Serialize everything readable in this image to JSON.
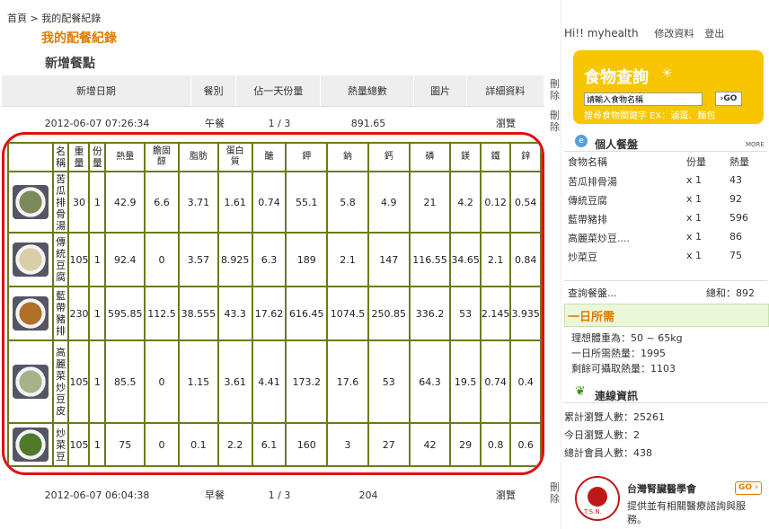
{
  "breadcrumb": {
    "home": "首頁",
    "sep": ">",
    "current": "我的配餐紀錄"
  },
  "page_title": "我的配餐紀錄",
  "section_title": "新增餐點",
  "meal_table": {
    "headers": [
      "新增日期",
      "餐別",
      "佔一天份量",
      "熱量總數",
      "圖片",
      "詳細資料"
    ],
    "delete_label": "刪除",
    "rows": [
      {
        "date": "2012-06-07 07:26:34",
        "meal": "午餐",
        "portion": "1 / 3",
        "calories": "891.65",
        "detail": "瀏覽"
      },
      {
        "date": "2012-06-07 06:04:38",
        "meal": "早餐",
        "portion": "1 / 3",
        "calories": "204",
        "detail": "瀏覽"
      }
    ]
  },
  "nutrition": {
    "headers": [
      "",
      "名稱",
      "重量",
      "份量",
      "熱量",
      "膽固醇",
      "脂肪",
      "蛋白質",
      "醣",
      "鉀",
      "鈉",
      "鈣",
      "磷",
      "鎂",
      "鐵",
      "鋅"
    ],
    "rows": [
      {
        "name": "苦瓜排骨湯",
        "values": [
          "30",
          "1",
          "42.9",
          "6.6",
          "3.71",
          "1.61",
          "0.74",
          "55.1",
          "5.8",
          "4.9",
          "21",
          "4.2",
          "0.12",
          "0.54"
        ],
        "img_color": "#7a8a5a"
      },
      {
        "name": "傳統豆腐",
        "values": [
          "105",
          "1",
          "92.4",
          "0",
          "3.57",
          "8.925",
          "6.3",
          "189",
          "2.1",
          "147",
          "116.55",
          "34.65",
          "2.1",
          "0.84"
        ],
        "img_color": "#d8cfa8"
      },
      {
        "name": "藍帶豬排",
        "values": [
          "230",
          "1",
          "595.85",
          "112.5",
          "38.555",
          "43.3",
          "17.62",
          "616.45",
          "1074.5",
          "250.85",
          "336.2",
          "53",
          "2.145",
          "3.935"
        ],
        "img_color": "#b0702a"
      },
      {
        "name": "高麗菜炒豆皮",
        "values": [
          "105",
          "1",
          "85.5",
          "0",
          "1.15",
          "3.61",
          "4.41",
          "173.2",
          "17.6",
          "53",
          "64.3",
          "19.5",
          "0.74",
          "0.4"
        ],
        "img_color": "#a8b28a"
      },
      {
        "name": "炒菜豆",
        "values": [
          "105",
          "1",
          "75",
          "0",
          "0.1",
          "2.2",
          "6.1",
          "160",
          "3",
          "27",
          "42",
          "29",
          "0.8",
          "0.6"
        ],
        "img_color": "#4f7a2a"
      }
    ]
  },
  "user": {
    "greeting": "Hi!! myhealth",
    "edit": "修改資料",
    "logout": "登出"
  },
  "food_search": {
    "title": "食物查詢",
    "placeholder": "請輸入食物名稱",
    "go": "GO",
    "hint": "搜尋食物關鍵字 EX：滷蛋、麵包"
  },
  "personal_meal": {
    "title": "個人餐盤",
    "more": "MORE",
    "headers": [
      "食物名稱",
      "份量",
      "熱量"
    ],
    "items": [
      {
        "name": "苦瓜排骨湯",
        "qty": "x 1",
        "cal": "43"
      },
      {
        "name": "傳統豆腐",
        "qty": "x 1",
        "cal": "92"
      },
      {
        "name": "藍帶豬排",
        "qty": "x 1",
        "cal": "596"
      },
      {
        "name": "高麗菜炒豆....",
        "qty": "x 1",
        "cal": "86"
      },
      {
        "name": "炒菜豆",
        "qty": "x 1",
        "cal": "75"
      }
    ],
    "query": "查詢餐盤...",
    "total": "總和：892"
  },
  "daily_need": {
    "title": "一日所需",
    "lines": [
      "理想體重為：50 ~ 65kg",
      "一日所需熱量：1995",
      "剩餘可攝取熱量：1103"
    ]
  },
  "connection": {
    "title": "連線資訊",
    "lines": [
      "累計瀏覽人數：25261",
      "今日瀏覽人數：2",
      "總計會員人數：438"
    ]
  },
  "society": {
    "name": "台灣腎臟醫學會",
    "desc": "提供並有相關醫療諮詢與服務。",
    "go": "GO",
    "logo_text": "T.S.N."
  },
  "colors": {
    "accent": "#e07b00",
    "highlight_border": "#e01010",
    "table_border": "#6b7a1a",
    "search_bg": "#f7c600"
  }
}
